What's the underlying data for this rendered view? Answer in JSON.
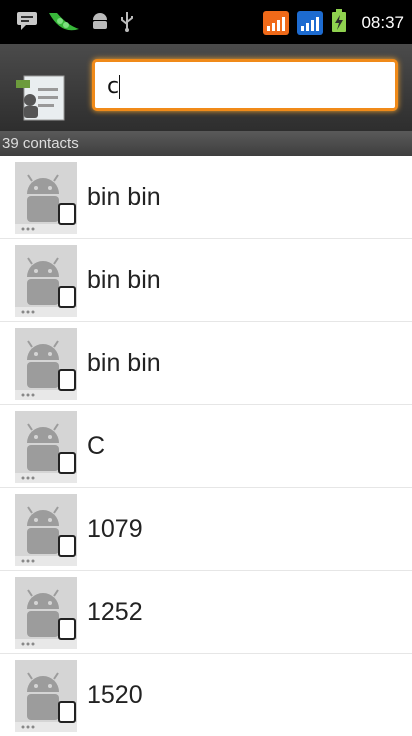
{
  "status_bar": {
    "time": "08:37",
    "left_icons": [
      "message-icon",
      "pea-pod-icon",
      "android-robot-icon",
      "usb-icon"
    ],
    "right_icons": [
      "signal-orange-icon",
      "signal-blue-icon",
      "battery-charging-icon"
    ]
  },
  "search": {
    "value": "c"
  },
  "contacts_count": "39 contacts",
  "contacts": [
    {
      "name": "bin bin"
    },
    {
      "name": "bin bin"
    },
    {
      "name": "bin bin"
    },
    {
      "name": "C"
    },
    {
      "name": "1079"
    },
    {
      "name": "1252"
    },
    {
      "name": "1520"
    }
  ],
  "colors": {
    "accent": "#f08a19",
    "status_bar": "#000000",
    "header": "#3b3b3b"
  }
}
